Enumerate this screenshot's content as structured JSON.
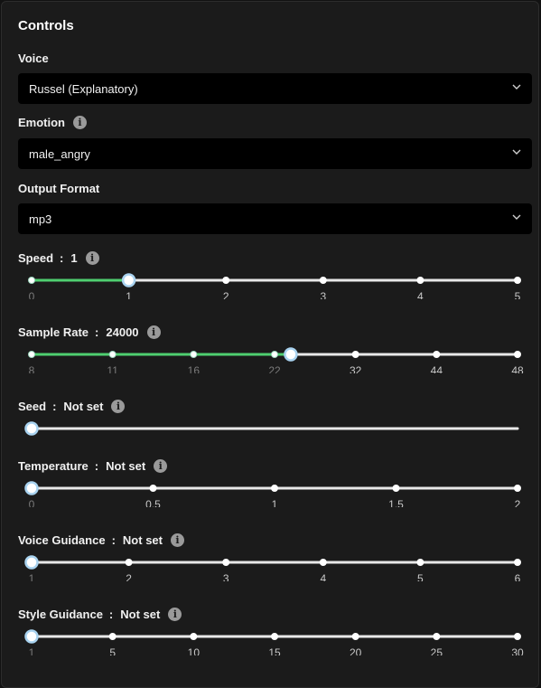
{
  "panel": {
    "title": "Controls"
  },
  "voice": {
    "label": "Voice",
    "value": "Russel (Explanatory)",
    "chevron_icon": "chevron-down-icon"
  },
  "emotion": {
    "label": "Emotion",
    "value": "male_angry",
    "info_icon": "info-icon",
    "chevron_icon": "chevron-down-icon"
  },
  "output_format": {
    "label": "Output Format",
    "value": "mp3",
    "chevron_icon": "chevron-down-icon"
  },
  "sliders": {
    "speed": {
      "label": "Speed",
      "value_text": "1",
      "value": 1,
      "min": 0,
      "max": 5,
      "ticks": [
        "0",
        "1",
        "2",
        "3",
        "4",
        "5"
      ],
      "tick_values": [
        0,
        1,
        2,
        3,
        4,
        5
      ],
      "filled": true
    },
    "sample_rate": {
      "label": "Sample Rate",
      "value_text": "24000",
      "value": 24,
      "min": 8,
      "max": 48,
      "ticks": [
        "8",
        "11",
        "16",
        "22",
        "32",
        "44",
        "48"
      ],
      "tick_values": [
        8,
        11,
        16,
        22,
        32,
        44,
        48
      ],
      "filled": true
    },
    "seed": {
      "label": "Seed",
      "value_text": "Not set",
      "filled": false
    },
    "temperature": {
      "label": "Temperature",
      "value_text": "Not set",
      "min": 0,
      "max": 2,
      "ticks": [
        "0",
        "0.5",
        "1",
        "1.5",
        "2"
      ],
      "tick_values": [
        0,
        0.5,
        1,
        1.5,
        2
      ],
      "filled": false
    },
    "voice_guidance": {
      "label": "Voice Guidance",
      "value_text": "Not set",
      "min": 1,
      "max": 6,
      "ticks": [
        "1",
        "2",
        "3",
        "4",
        "5",
        "6"
      ],
      "tick_values": [
        1,
        2,
        3,
        4,
        5,
        6
      ],
      "filled": false
    },
    "style_guidance": {
      "label": "Style Guidance",
      "value_text": "Not set",
      "min": 1,
      "max": 30,
      "ticks": [
        "1",
        "5",
        "10",
        "15",
        "20",
        "25",
        "30"
      ],
      "tick_values": [
        1,
        5,
        10,
        15,
        20,
        25,
        30
      ],
      "filled": false
    }
  },
  "colors": {
    "track": "#e8e8e8",
    "fill": "#4fcf70",
    "thumb_ring": "#a9d3f0",
    "tick_label_active": "#7a7a7a",
    "tick_label": "#c8c8c8"
  }
}
